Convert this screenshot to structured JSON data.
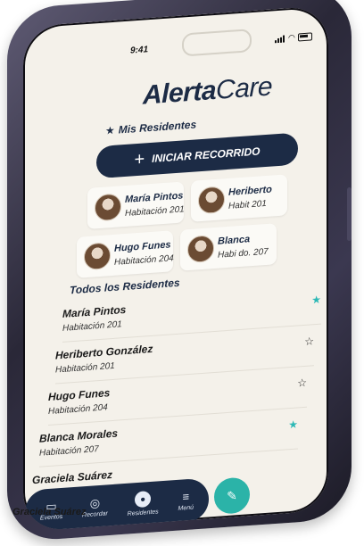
{
  "status_bar": {
    "time": "9:41"
  },
  "app": {
    "logo_bold": "Alerta",
    "logo_light": "Care"
  },
  "favorites": {
    "title": "Mis Residentes",
    "cta_label": "INICIAR RECORRIDO",
    "cards": [
      {
        "name": "María Pintos",
        "room": "Habitación 201"
      },
      {
        "name": "Heriberto",
        "room": "Habit 201"
      },
      {
        "name": "Hugo Funes",
        "room": "Habitación 204"
      },
      {
        "name": "Blanca",
        "room": "Habi do. 207"
      }
    ]
  },
  "all_residents": {
    "title": "Todos los Residentes",
    "items": [
      {
        "name": "María Pintos",
        "room": "Habitación 201",
        "favorite": true
      },
      {
        "name": "Heriberto González",
        "room": "Habitación 201",
        "favorite": false
      },
      {
        "name": "Hugo Funes",
        "room": "Habitación 204",
        "favorite": false
      },
      {
        "name": "Blanca Morales",
        "room": "Habitación 207",
        "favorite": true
      },
      {
        "name": "Graciela Suárez",
        "room": "",
        "favorite": false
      }
    ]
  },
  "bottom_nav": {
    "items": [
      {
        "label": "Eventos",
        "icon": "calendar-icon"
      },
      {
        "label": "Recordar",
        "icon": "reminder-icon"
      },
      {
        "label": "Residentes",
        "icon": "residents-icon"
      },
      {
        "label": "Menú",
        "icon": "menu-icon"
      }
    ],
    "fab_icon": "edit-icon"
  },
  "overflow_name": "Graciela Suárez",
  "colors": {
    "navy": "#1c2b45",
    "teal": "#2bb3a8",
    "background": "#f4f1ea"
  }
}
